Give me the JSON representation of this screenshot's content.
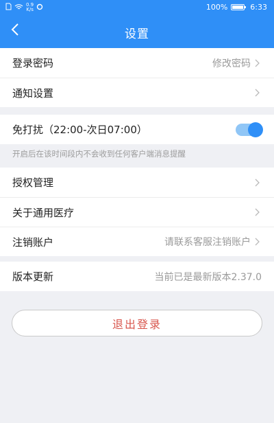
{
  "status_bar": {
    "network_speed_value": "0.9",
    "network_speed_unit": "K/s",
    "battery": "100%",
    "time": "6:33"
  },
  "header": {
    "title": "设置"
  },
  "group1": {
    "login_password": {
      "label": "登录密码",
      "value": "修改密码"
    },
    "notification_settings": {
      "label": "通知设置"
    }
  },
  "group2": {
    "do_not_disturb": {
      "label": "免打扰（22:00-次日07:00）",
      "enabled": true
    },
    "hint": "开启后在该时间段内不会收到任何客户端消息提醒"
  },
  "group3": {
    "authorization": {
      "label": "授权管理"
    },
    "about": {
      "label": "关于通用医疗"
    },
    "cancel_account": {
      "label": "注销账户",
      "value": "请联系客服注销账户"
    }
  },
  "group4": {
    "version_update": {
      "label": "版本更新",
      "value": "当前已是最新版本2.37.0"
    }
  },
  "logout": {
    "label": "退出登录"
  },
  "colors": {
    "header_blue": "#2f8ff7",
    "logout_red": "#d8564d",
    "page_bg": "#eff0f4"
  }
}
